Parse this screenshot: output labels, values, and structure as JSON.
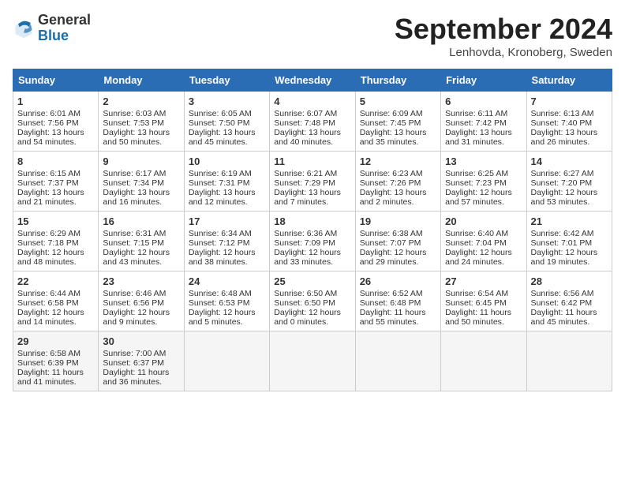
{
  "header": {
    "logo_general": "General",
    "logo_blue": "Blue",
    "month_title": "September 2024",
    "location": "Lenhovda, Kronoberg, Sweden"
  },
  "weekdays": [
    "Sunday",
    "Monday",
    "Tuesday",
    "Wednesday",
    "Thursday",
    "Friday",
    "Saturday"
  ],
  "weeks": [
    [
      {
        "day": "1",
        "sunrise": "Sunrise: 6:01 AM",
        "sunset": "Sunset: 7:56 PM",
        "daylight": "Daylight: 13 hours and 54 minutes."
      },
      {
        "day": "2",
        "sunrise": "Sunrise: 6:03 AM",
        "sunset": "Sunset: 7:53 PM",
        "daylight": "Daylight: 13 hours and 50 minutes."
      },
      {
        "day": "3",
        "sunrise": "Sunrise: 6:05 AM",
        "sunset": "Sunset: 7:50 PM",
        "daylight": "Daylight: 13 hours and 45 minutes."
      },
      {
        "day": "4",
        "sunrise": "Sunrise: 6:07 AM",
        "sunset": "Sunset: 7:48 PM",
        "daylight": "Daylight: 13 hours and 40 minutes."
      },
      {
        "day": "5",
        "sunrise": "Sunrise: 6:09 AM",
        "sunset": "Sunset: 7:45 PM",
        "daylight": "Daylight: 13 hours and 35 minutes."
      },
      {
        "day": "6",
        "sunrise": "Sunrise: 6:11 AM",
        "sunset": "Sunset: 7:42 PM",
        "daylight": "Daylight: 13 hours and 31 minutes."
      },
      {
        "day": "7",
        "sunrise": "Sunrise: 6:13 AM",
        "sunset": "Sunset: 7:40 PM",
        "daylight": "Daylight: 13 hours and 26 minutes."
      }
    ],
    [
      {
        "day": "8",
        "sunrise": "Sunrise: 6:15 AM",
        "sunset": "Sunset: 7:37 PM",
        "daylight": "Daylight: 13 hours and 21 minutes."
      },
      {
        "day": "9",
        "sunrise": "Sunrise: 6:17 AM",
        "sunset": "Sunset: 7:34 PM",
        "daylight": "Daylight: 13 hours and 16 minutes."
      },
      {
        "day": "10",
        "sunrise": "Sunrise: 6:19 AM",
        "sunset": "Sunset: 7:31 PM",
        "daylight": "Daylight: 13 hours and 12 minutes."
      },
      {
        "day": "11",
        "sunrise": "Sunrise: 6:21 AM",
        "sunset": "Sunset: 7:29 PM",
        "daylight": "Daylight: 13 hours and 7 minutes."
      },
      {
        "day": "12",
        "sunrise": "Sunrise: 6:23 AM",
        "sunset": "Sunset: 7:26 PM",
        "daylight": "Daylight: 13 hours and 2 minutes."
      },
      {
        "day": "13",
        "sunrise": "Sunrise: 6:25 AM",
        "sunset": "Sunset: 7:23 PM",
        "daylight": "Daylight: 12 hours and 57 minutes."
      },
      {
        "day": "14",
        "sunrise": "Sunrise: 6:27 AM",
        "sunset": "Sunset: 7:20 PM",
        "daylight": "Daylight: 12 hours and 53 minutes."
      }
    ],
    [
      {
        "day": "15",
        "sunrise": "Sunrise: 6:29 AM",
        "sunset": "Sunset: 7:18 PM",
        "daylight": "Daylight: 12 hours and 48 minutes."
      },
      {
        "day": "16",
        "sunrise": "Sunrise: 6:31 AM",
        "sunset": "Sunset: 7:15 PM",
        "daylight": "Daylight: 12 hours and 43 minutes."
      },
      {
        "day": "17",
        "sunrise": "Sunrise: 6:34 AM",
        "sunset": "Sunset: 7:12 PM",
        "daylight": "Daylight: 12 hours and 38 minutes."
      },
      {
        "day": "18",
        "sunrise": "Sunrise: 6:36 AM",
        "sunset": "Sunset: 7:09 PM",
        "daylight": "Daylight: 12 hours and 33 minutes."
      },
      {
        "day": "19",
        "sunrise": "Sunrise: 6:38 AM",
        "sunset": "Sunset: 7:07 PM",
        "daylight": "Daylight: 12 hours and 29 minutes."
      },
      {
        "day": "20",
        "sunrise": "Sunrise: 6:40 AM",
        "sunset": "Sunset: 7:04 PM",
        "daylight": "Daylight: 12 hours and 24 minutes."
      },
      {
        "day": "21",
        "sunrise": "Sunrise: 6:42 AM",
        "sunset": "Sunset: 7:01 PM",
        "daylight": "Daylight: 12 hours and 19 minutes."
      }
    ],
    [
      {
        "day": "22",
        "sunrise": "Sunrise: 6:44 AM",
        "sunset": "Sunset: 6:58 PM",
        "daylight": "Daylight: 12 hours and 14 minutes."
      },
      {
        "day": "23",
        "sunrise": "Sunrise: 6:46 AM",
        "sunset": "Sunset: 6:56 PM",
        "daylight": "Daylight: 12 hours and 9 minutes."
      },
      {
        "day": "24",
        "sunrise": "Sunrise: 6:48 AM",
        "sunset": "Sunset: 6:53 PM",
        "daylight": "Daylight: 12 hours and 5 minutes."
      },
      {
        "day": "25",
        "sunrise": "Sunrise: 6:50 AM",
        "sunset": "Sunset: 6:50 PM",
        "daylight": "Daylight: 12 hours and 0 minutes."
      },
      {
        "day": "26",
        "sunrise": "Sunrise: 6:52 AM",
        "sunset": "Sunset: 6:48 PM",
        "daylight": "Daylight: 11 hours and 55 minutes."
      },
      {
        "day": "27",
        "sunrise": "Sunrise: 6:54 AM",
        "sunset": "Sunset: 6:45 PM",
        "daylight": "Daylight: 11 hours and 50 minutes."
      },
      {
        "day": "28",
        "sunrise": "Sunrise: 6:56 AM",
        "sunset": "Sunset: 6:42 PM",
        "daylight": "Daylight: 11 hours and 45 minutes."
      }
    ],
    [
      {
        "day": "29",
        "sunrise": "Sunrise: 6:58 AM",
        "sunset": "Sunset: 6:39 PM",
        "daylight": "Daylight: 11 hours and 41 minutes."
      },
      {
        "day": "30",
        "sunrise": "Sunrise: 7:00 AM",
        "sunset": "Sunset: 6:37 PM",
        "daylight": "Daylight: 11 hours and 36 minutes."
      },
      null,
      null,
      null,
      null,
      null
    ]
  ]
}
